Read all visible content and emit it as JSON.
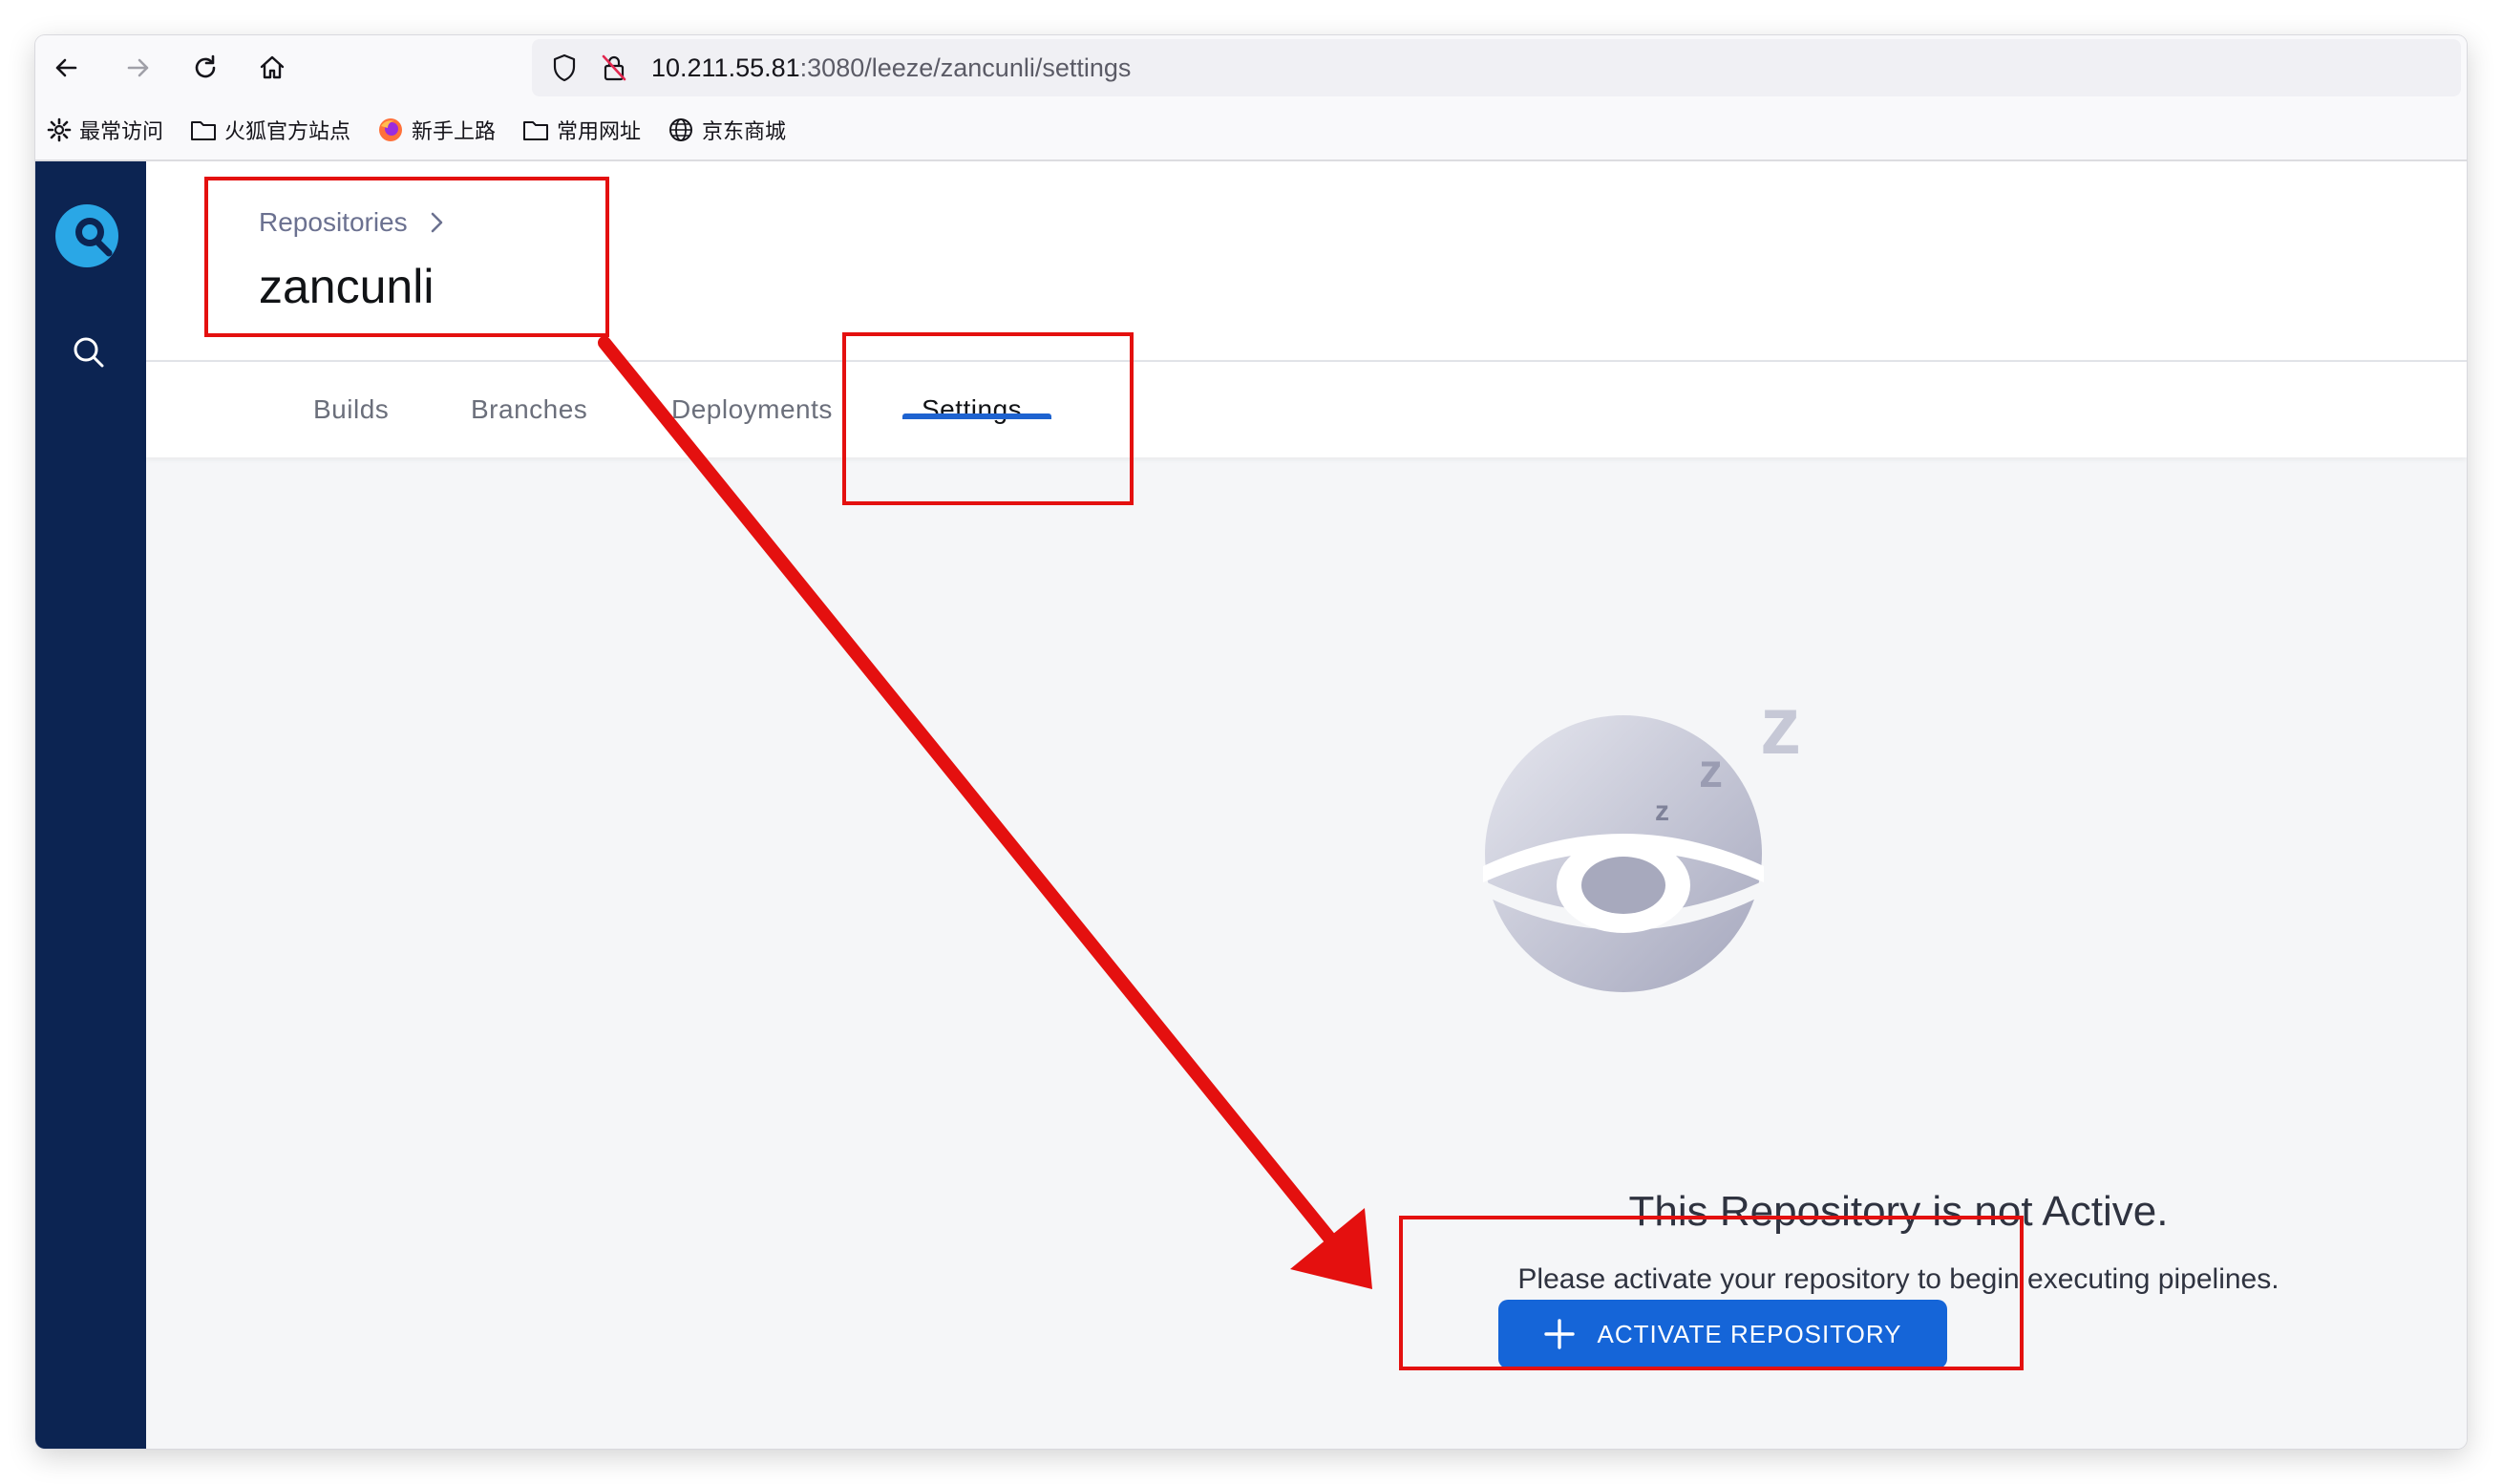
{
  "browser": {
    "url_host": "10.211.55.81",
    "url_path": ":3080/leeze/zancunli/settings",
    "bookmarks": [
      {
        "label": "最常访问",
        "icon": "gear-icon"
      },
      {
        "label": "火狐官方站点",
        "icon": "folder-icon"
      },
      {
        "label": "新手上路",
        "icon": "firefox-icon"
      },
      {
        "label": "常用网址",
        "icon": "folder-icon"
      },
      {
        "label": "京东商城",
        "icon": "globe-icon"
      }
    ]
  },
  "header": {
    "breadcrumb": "Repositories",
    "title": "zancunli"
  },
  "tabs": [
    {
      "label": "Builds"
    },
    {
      "label": "Branches"
    },
    {
      "label": "Deployments"
    },
    {
      "label": "Settings",
      "active": true
    }
  ],
  "empty_state": {
    "title": "This Repository is not Active.",
    "description": "Please activate your repository to begin executing pipelines.",
    "button_label": "ACTIVATE REPOSITORY"
  },
  "colors": {
    "sidebar": "#0c2452",
    "accent": "#1565d8",
    "annotation": "#e4100f"
  }
}
